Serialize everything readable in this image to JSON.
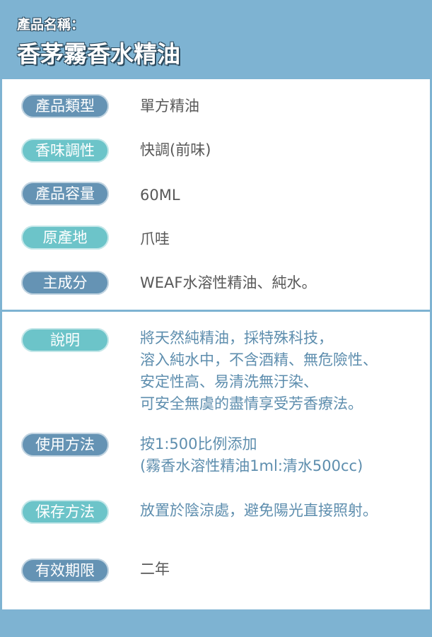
{
  "header": {
    "label": "產品名稱：",
    "title": "香茅霧香水精油"
  },
  "specs": [
    {
      "label": "產品類型",
      "value": "單方精油"
    },
    {
      "label": "香味調性",
      "value": "快調(前味)"
    },
    {
      "label": "產品容量",
      "value": "60ML"
    },
    {
      "label": "原產地",
      "value": "爪哇"
    },
    {
      "label": "主成分",
      "value": "WEAF水溶性精油、純水。"
    }
  ],
  "details": {
    "description": {
      "label": "說明",
      "lines": [
        "將天然純精油，採特殊科技，",
        "溶入純水中，不含酒精、無危險性、",
        "安定性高、易清洗無汙染、",
        "可安全無虞的盡情享受芳香療法。"
      ]
    },
    "usage": {
      "label": "使用方法",
      "lines": [
        "按1:500比例添加",
        "(霧香水溶性精油1ml:清水500cc)"
      ]
    },
    "storage": {
      "label": "保存方法",
      "value": "放置於陰涼處，避免陽光直接照射。"
    },
    "shelf_life": {
      "label": "有效期限",
      "value": "二年"
    }
  },
  "colors": {
    "background": "#7eb3d2",
    "pill_blue": "#6593b4",
    "pill_teal": "#6cc4c9",
    "text_gray": "#585858",
    "text_blue": "#5e8eae"
  }
}
